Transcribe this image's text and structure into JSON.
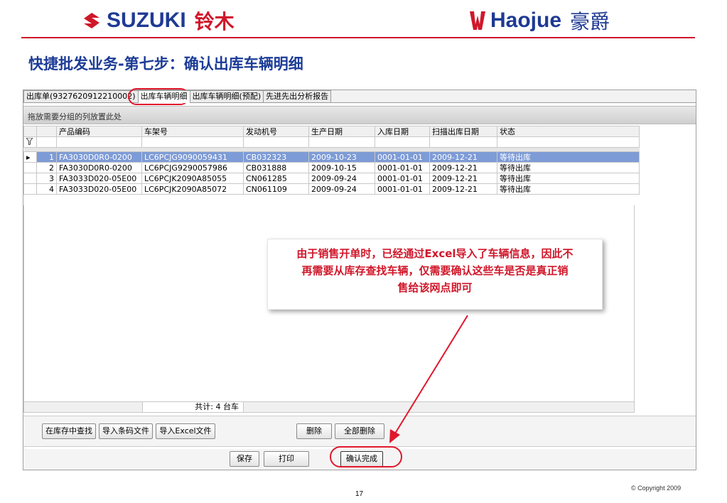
{
  "header": {
    "suzuki_brand": "SUZUKI",
    "suzuki_cn": "铃木",
    "haojue_brand": "Haojue",
    "haojue_cn": "豪爵"
  },
  "slide_title": "快捷批发业务-第七步：确认出库车辆明细",
  "tabs": [
    {
      "label": "出库单(9327620912210002)"
    },
    {
      "label": "出库车辆明细"
    },
    {
      "label": "出库车辆明细(预配)"
    },
    {
      "label": "先进先出分析报告"
    }
  ],
  "group_hint": "拖放需要分组的列放置此处",
  "columns": [
    "产品编码",
    "车架号",
    "发动机号",
    "生产日期",
    "入库日期",
    "扫描出库日期",
    "状态"
  ],
  "filter_icon": "𝟱",
  "rows": [
    {
      "no": "1",
      "product_code": "FA3030D0R0-0200",
      "frame_no": "LC6PCJG9090059431",
      "engine_no": "CB032323",
      "prod_date": "2009-10-23",
      "in_date": "0001-01-01",
      "scan_date": "2009-12-21",
      "status": "等待出库"
    },
    {
      "no": "2",
      "product_code": "FA3030D0R0-0200",
      "frame_no": "LC6PCJG9290057986",
      "engine_no": "CB031888",
      "prod_date": "2009-10-15",
      "in_date": "0001-01-01",
      "scan_date": "2009-12-21",
      "status": "等待出库"
    },
    {
      "no": "3",
      "product_code": "FA3033D020-05E00",
      "frame_no": "LC6PCJK2090A85055",
      "engine_no": "CN061285",
      "prod_date": "2009-09-24",
      "in_date": "0001-01-01",
      "scan_date": "2009-12-21",
      "status": "等待出库"
    },
    {
      "no": "4",
      "product_code": "FA3033D020-05E00",
      "frame_no": "LC6PCJK2090A85072",
      "engine_no": "CN061109",
      "prod_date": "2009-09-24",
      "in_date": "0001-01-01",
      "scan_date": "2009-12-21",
      "status": "等待出库"
    }
  ],
  "total_label": "共计: 4 台车",
  "buttons": {
    "find_in_stock": "在库存中查找",
    "import_barcode": "导入条码文件",
    "import_excel": "导入Excel文件",
    "delete": "删除",
    "delete_all": "全部删除",
    "save": "保存",
    "print": "打印",
    "confirm": "确认完成"
  },
  "callout": {
    "line1": "由于销售开单时，已经通过Excel导入了车辆信息，因此不",
    "line2": "再需要从库存查找车辆，仅需要确认这些车是否是真正销",
    "line3": "售给该网点即可"
  },
  "page_number": "17",
  "copyright": "© Copyright  2009",
  "colors": {
    "brand_blue": "#1f3a93",
    "accent_red": "#d0172a",
    "selection": "#7d9bd6"
  }
}
